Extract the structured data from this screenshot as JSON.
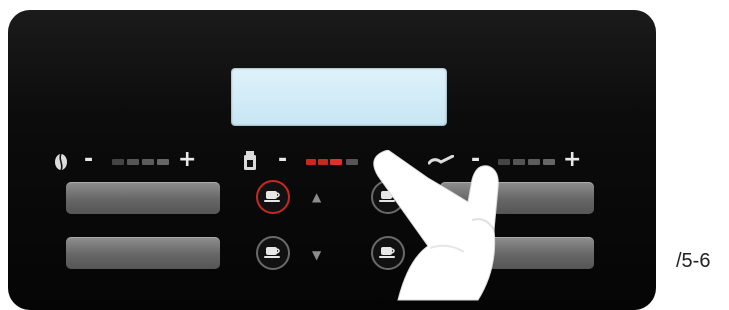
{
  "panel": {
    "display_text": "",
    "strength": {
      "minus": "-",
      "plus": "+",
      "icon": "coffee-bean-icon"
    },
    "quantity": {
      "minus": "-",
      "plus": "+",
      "icon": "cup-size-icon",
      "active_color": "#c8291f"
    },
    "milk": {
      "minus": "-",
      "plus": "+",
      "icon": "milk-spoon-icon"
    },
    "buttons": {
      "top_left_bar": "",
      "bottom_left_bar": "",
      "cup_icon": "coffee-cup-icon",
      "arrow_up": "▲",
      "arrow_down": "▼"
    }
  },
  "caption": "/5-6"
}
